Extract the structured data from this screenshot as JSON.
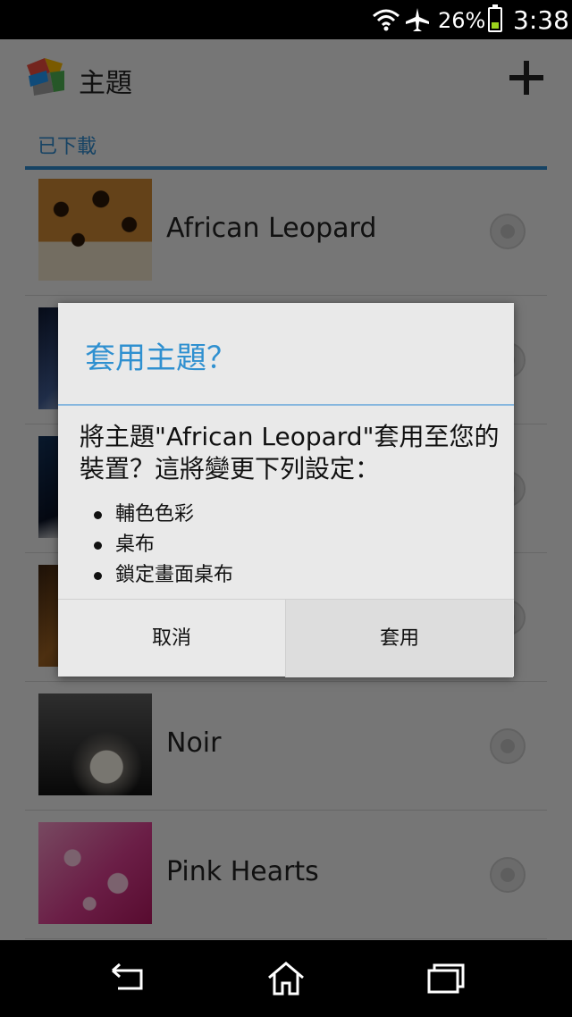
{
  "status_bar": {
    "battery_percent": "26%",
    "time": "3:38",
    "battery_level": 0.26
  },
  "header": {
    "title": "主題"
  },
  "section": {
    "label": "已下載"
  },
  "themes": [
    {
      "name": "African Leopard"
    },
    {
      "name": ""
    },
    {
      "name": ""
    },
    {
      "name": ""
    },
    {
      "name": "Noir"
    },
    {
      "name": "Pink Hearts"
    }
  ],
  "dialog": {
    "title": "套用主題？",
    "message": "將主題\"African Leopard\"套用至您的裝置？這將變更下列設定：",
    "items": [
      "輔色色彩",
      "桌布",
      "鎖定畫面桌布"
    ],
    "cancel_label": "取消",
    "apply_label": "套用"
  },
  "colors": {
    "accent": "#2f90d0",
    "overlay": "rgba(0,0,0,0.5)"
  },
  "icons": [
    "wifi-icon",
    "airplane-icon",
    "battery-icon",
    "add-icon",
    "back-icon",
    "home-icon",
    "recent-apps-icon"
  ]
}
